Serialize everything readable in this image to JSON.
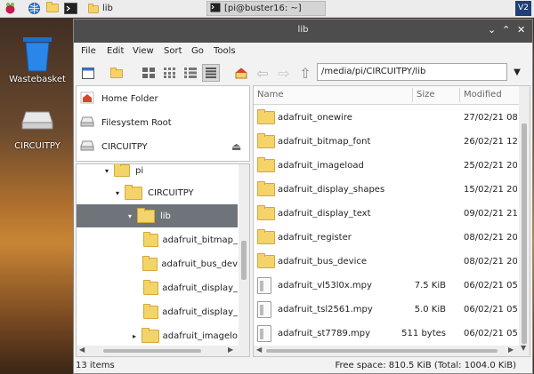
{
  "taskbar": {
    "tasks": [
      {
        "label": "lib",
        "active": false
      },
      {
        "label": "[pi@buster16: ~]",
        "active": true
      }
    ],
    "tray_label": "V2"
  },
  "desktop": {
    "icons": [
      {
        "label": "Wastebasket"
      },
      {
        "label": "CIRCUITPY"
      }
    ]
  },
  "window": {
    "title": "lib",
    "controls": [
      "⌄",
      "⌃",
      "✕"
    ],
    "menu": [
      "File",
      "Edit",
      "View",
      "Sort",
      "Go",
      "Tools"
    ],
    "path": "/media/pi/CIRCUITPY/lib",
    "places": [
      {
        "label": "Home Folder",
        "icon": "home-icon"
      },
      {
        "label": "Filesystem Root",
        "icon": "drive-icon"
      },
      {
        "label": "CIRCUITPY",
        "icon": "drive-icon"
      }
    ],
    "tree": [
      {
        "label": "pi",
        "indent": 1,
        "arrow": "▾",
        "selected": false
      },
      {
        "label": "CIRCUITPY",
        "indent": 2,
        "arrow": "▾",
        "selected": false
      },
      {
        "label": "lib",
        "indent": 3,
        "arrow": "▾",
        "selected": true
      },
      {
        "label": "adafruit_bitmap_",
        "indent": 4,
        "arrow": "",
        "selected": false
      },
      {
        "label": "adafruit_bus_dev",
        "indent": 4,
        "arrow": "",
        "selected": false
      },
      {
        "label": "adafruit_display_",
        "indent": 4,
        "arrow": "",
        "selected": false
      },
      {
        "label": "adafruit_display_",
        "indent": 4,
        "arrow": "",
        "selected": false
      },
      {
        "label": "adafruit_imagelo",
        "indent": 4,
        "arrow": "▸",
        "selected": false
      }
    ],
    "columns": {
      "name": "Name",
      "size": "Size",
      "modified": "Modified"
    },
    "files": [
      {
        "name": "adafruit_onewire",
        "size": "",
        "modified": "27/02/21 08:5",
        "type": "folder"
      },
      {
        "name": "adafruit_bitmap_font",
        "size": "",
        "modified": "26/02/21 12:3",
        "type": "folder"
      },
      {
        "name": "adafruit_imageload",
        "size": "",
        "modified": "25/02/21 20:2",
        "type": "folder"
      },
      {
        "name": "adafruit_display_shapes",
        "size": "",
        "modified": "15/02/21 20:2",
        "type": "folder"
      },
      {
        "name": "adafruit_display_text",
        "size": "",
        "modified": "09/02/21 21:1",
        "type": "folder"
      },
      {
        "name": "adafruit_register",
        "size": "",
        "modified": "08/02/21 20:0",
        "type": "folder"
      },
      {
        "name": "adafruit_bus_device",
        "size": "",
        "modified": "08/02/21 20:0",
        "type": "folder"
      },
      {
        "name": "adafruit_vl53l0x.mpy",
        "size": "7.5 KiB",
        "modified": "06/02/21 05:1",
        "type": "file"
      },
      {
        "name": "adafruit_tsl2561.mpy",
        "size": "5.0 KiB",
        "modified": "06/02/21 05:1",
        "type": "file"
      },
      {
        "name": "adafruit_st7789.mpy",
        "size": "511 bytes",
        "modified": "06/02/21 05:1",
        "type": "file"
      }
    ],
    "status": {
      "count": "13 items",
      "free": "Free space: 810.5 KiB (Total: 1004.0 KiB)"
    }
  },
  "colors": {
    "titlebar": "#4d4d4d",
    "selection": "#6e747a",
    "folder": "#f5d36b"
  }
}
